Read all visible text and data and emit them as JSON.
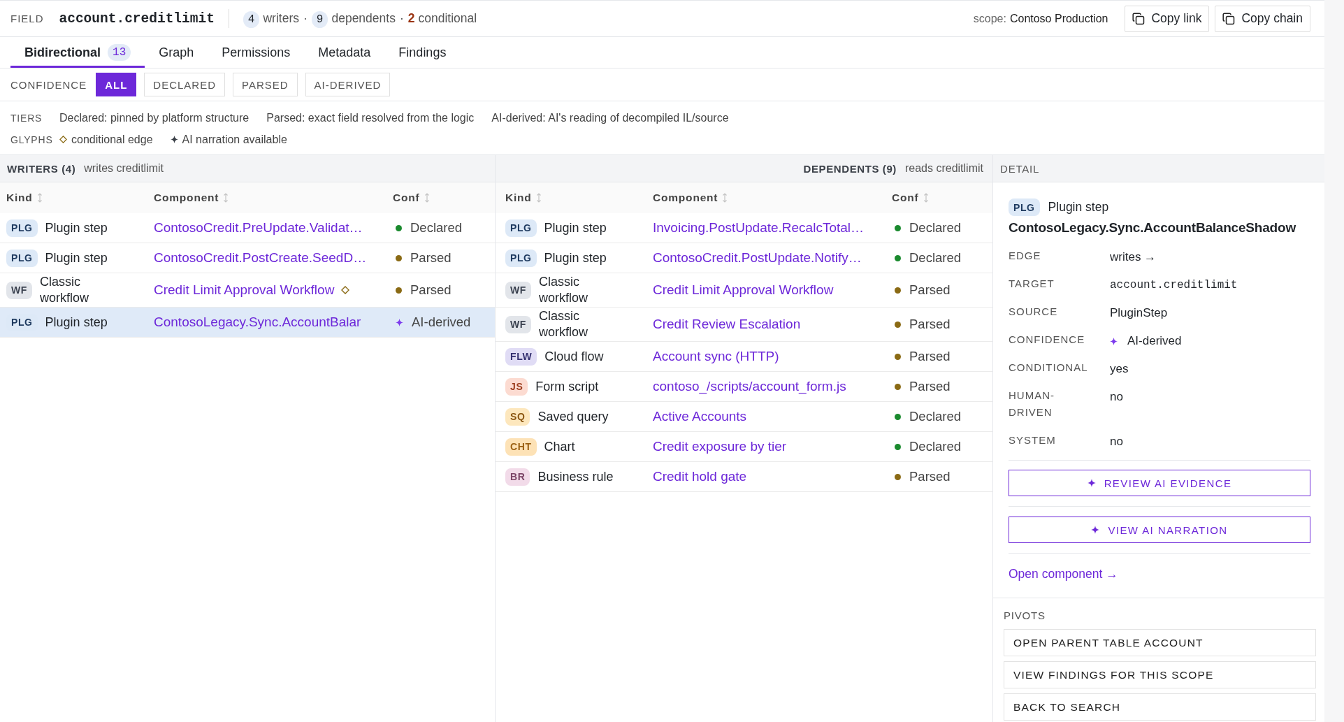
{
  "header": {
    "field_label": "FIELD",
    "field": "account.creditlimit",
    "summary": [
      {
        "kind": "count",
        "count": "4",
        "unit": "writers"
      },
      {
        "kind": "count",
        "sep": "·",
        "count": "9",
        "unit": "dependents"
      },
      {
        "kind": "warn",
        "sep": "·",
        "count": "2",
        "unit": "conditional"
      }
    ],
    "scope_label": "scope:",
    "scope": "Contoso Production",
    "buttons": [
      {
        "label": "Copy link"
      },
      {
        "label": "Copy chain"
      }
    ]
  },
  "tabs": [
    {
      "label": "Bidirectional",
      "count": "13",
      "selected": true
    },
    {
      "label": "Graph",
      "selected": false
    },
    {
      "label": "Permissions",
      "selected": false
    },
    {
      "label": "Metadata",
      "selected": false
    },
    {
      "label": "Findings",
      "selected": false
    }
  ],
  "confidence_filter": {
    "label": "CONFIDENCE",
    "options": [
      {
        "label": "ALL",
        "selected": true
      },
      {
        "label": "DECLARED",
        "selected": false
      },
      {
        "label": "PARSED",
        "selected": false
      },
      {
        "label": "AI-DERIVED",
        "selected": false
      }
    ]
  },
  "legend": {
    "tiers_label": "TIERS",
    "tiers": [
      "Declared: pinned by platform structure",
      "Parsed: exact field resolved from the logic",
      "AI-derived: AI's reading of decompiled IL/source"
    ],
    "glyphs_label": "GLYPHS",
    "glyphs": [
      {
        "kind": "diamond",
        "label": "conditional edge"
      },
      {
        "kind": "sparkle",
        "label": "AI narration available"
      }
    ]
  },
  "writers": {
    "title": "WRITERS (4)",
    "subtitle": "writes creditlimit",
    "columns": [
      "Kind",
      "Component",
      "Conf"
    ],
    "rows": [
      {
        "badge": "PLG",
        "kind": "plg",
        "type": "Plugin step",
        "component": "ContosoCredit.PreUpdate.Validat…",
        "conditional": false,
        "conf": {
          "kind": "dot",
          "color": "#1a8a2e",
          "label": "Declared"
        },
        "selected": false
      },
      {
        "badge": "PLG",
        "kind": "plg",
        "type": "Plugin step",
        "component": "ContosoCredit.PostCreate.SeedD…",
        "conditional": false,
        "conf": {
          "kind": "dot",
          "color": "#8a6a14",
          "label": "Parsed"
        },
        "selected": false
      },
      {
        "badge": "WF",
        "kind": "wf",
        "type": "Classic workflow",
        "component": "Credit Limit Approval Workflow",
        "conditional": true,
        "conf": {
          "kind": "dot",
          "color": "#8a6a14",
          "label": "Parsed"
        },
        "selected": false
      },
      {
        "badge": "PLG",
        "kind": "plg",
        "type": "Plugin step",
        "component": "ContosoLegacy.Sync.AccountBalar",
        "conditional": false,
        "conf": {
          "kind": "sparkle",
          "color": "#7c3aed",
          "label": "AI-derived"
        },
        "selected": true
      }
    ]
  },
  "dependents": {
    "title": "DEPENDENTS (9)",
    "subtitle": "reads creditlimit",
    "columns": [
      "Kind",
      "Component",
      "Conf"
    ],
    "rows": [
      {
        "badge": "PLG",
        "kind": "plg",
        "type": "Plugin step",
        "component": "Invoicing.PostUpdate.RecalcTotal…",
        "conditional": false,
        "conf": {
          "kind": "dot",
          "color": "#1a8a2e",
          "label": "Declared"
        },
        "selected": false
      },
      {
        "badge": "PLG",
        "kind": "plg",
        "type": "Plugin step",
        "component": "ContosoCredit.PostUpdate.Notify…",
        "conditional": false,
        "conf": {
          "kind": "dot",
          "color": "#1a8a2e",
          "label": "Declared"
        },
        "selected": false
      },
      {
        "badge": "WF",
        "kind": "wf",
        "type": "Classic workflow",
        "component": "Credit Limit Approval Workflow",
        "conditional": false,
        "conf": {
          "kind": "dot",
          "color": "#8a6a14",
          "label": "Parsed"
        },
        "selected": false
      },
      {
        "badge": "WF",
        "kind": "wf",
        "type": "Classic workflow",
        "component": "Credit Review Escalation",
        "conditional": false,
        "conf": {
          "kind": "dot",
          "color": "#8a6a14",
          "label": "Parsed"
        },
        "selected": false
      },
      {
        "badge": "FLW",
        "kind": "flw",
        "type": "Cloud flow",
        "component": "Account sync (HTTP)",
        "conditional": false,
        "conf": {
          "kind": "dot",
          "color": "#8a6a14",
          "label": "Parsed"
        },
        "selected": false
      },
      {
        "badge": "JS",
        "kind": "js",
        "type": "Form script",
        "component": "contoso_/scripts/account_form.js",
        "conditional": false,
        "conf": {
          "kind": "dot",
          "color": "#8a6a14",
          "label": "Parsed"
        },
        "selected": false
      },
      {
        "badge": "SQ",
        "kind": "sq",
        "type": "Saved query",
        "component": "Active Accounts",
        "conditional": false,
        "conf": {
          "kind": "dot",
          "color": "#1a8a2e",
          "label": "Declared"
        },
        "selected": false
      },
      {
        "badge": "CHT",
        "kind": "cht",
        "type": "Chart",
        "component": "Credit exposure by tier",
        "conditional": false,
        "conf": {
          "kind": "dot",
          "color": "#1a8a2e",
          "label": "Declared"
        },
        "selected": false
      },
      {
        "badge": "BR",
        "kind": "br",
        "type": "Business rule",
        "component": "Credit hold gate",
        "conditional": false,
        "conf": {
          "kind": "dot",
          "color": "#8a6a14",
          "label": "Parsed"
        },
        "selected": false
      }
    ]
  },
  "detail": {
    "title": "DETAIL",
    "badge": "PLG",
    "kind": "plg",
    "type": "Plugin step",
    "name": "ContosoLegacy.Sync.AccountBalanceShadow",
    "fields": [
      {
        "label": "EDGE",
        "value": "writes →",
        "kind": "text"
      },
      {
        "label": "TARGET",
        "value": "account.creditlimit",
        "kind": "mono"
      },
      {
        "label": "SOURCE",
        "value": "PluginStep",
        "kind": "text"
      },
      {
        "label": "CONFIDENCE",
        "value": "AI-derived",
        "kind": "sparkle"
      },
      {
        "label": "CONDITIONAL",
        "value": "yes",
        "kind": "text"
      },
      {
        "label": "HUMAN-DRIVEN",
        "value": "no",
        "kind": "text"
      },
      {
        "label": "SYSTEM",
        "value": "no",
        "kind": "text"
      }
    ],
    "actions": [
      {
        "label": "REVIEW AI EVIDENCE"
      },
      {
        "label": "VIEW AI NARRATION"
      }
    ],
    "link": "Open component →"
  },
  "pivots": {
    "title": "PIVOTS",
    "items": [
      {
        "label": "OPEN PARENT TABLE ACCOUNT"
      },
      {
        "label": "VIEW FINDINGS FOR THIS SCOPE"
      },
      {
        "label": "BACK TO SEARCH"
      }
    ]
  }
}
